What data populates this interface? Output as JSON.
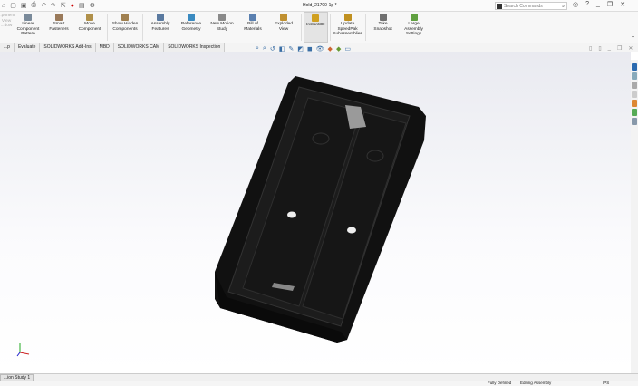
{
  "window": {
    "title": "Hold_21700-1p *",
    "search_placeholder": "Search Commands"
  },
  "ribbon": [
    {
      "label": "Linear Component Pattern",
      "color": "#7a8a9a"
    },
    {
      "label": "Smart Fasteners",
      "color": "#9a7a5a"
    },
    {
      "label": "Move Component",
      "color": "#b0904a"
    },
    {
      "label": "Show Hidden Components",
      "color": "#a08050"
    },
    {
      "label": "Assembly Features",
      "color": "#5a7aa0"
    },
    {
      "label": "Reference Geometry",
      "color": "#3a8ac0"
    },
    {
      "label": "New Motion Study",
      "color": "#8a8a8a"
    },
    {
      "label": "Bill of Materials",
      "color": "#5a80b0"
    },
    {
      "label": "Exploded View",
      "color": "#c09030"
    },
    {
      "label": "Instant3D",
      "color": "#d0a020"
    },
    {
      "label": "Update SpeedPak Subassemblies",
      "color": "#c09020"
    },
    {
      "label": "Take Snapshot",
      "color": "#707070"
    },
    {
      "label": "Large Assembly Settings",
      "color": "#60a040"
    }
  ],
  "ribbon_partial": "...ponent View ...dow",
  "tabs": [
    "...p",
    "Evaluate",
    "SOLIDWORKS Add-Ins",
    "MBD",
    "SOLIDWORKS CAM",
    "SOLIDWORKS Inspection"
  ],
  "bottom_tab": "...ion Study 1",
  "status": {
    "defined": "Fully Defined",
    "mode": "Editing Assembly",
    "units": "IPS"
  }
}
